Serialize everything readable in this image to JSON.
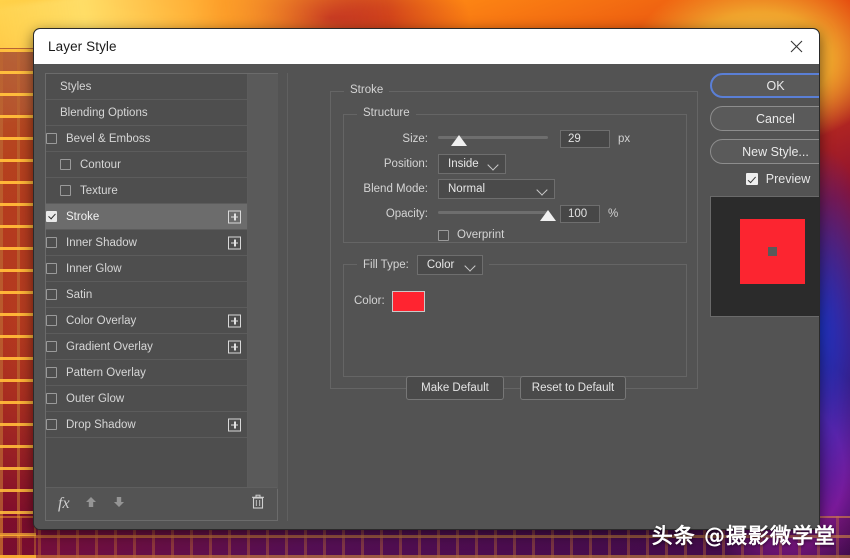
{
  "window": {
    "title": "Layer Style",
    "close_icon": "close-icon"
  },
  "styles_panel": {
    "items": [
      {
        "label": "Styles",
        "type": "plain",
        "checkbox": false,
        "checked": false,
        "indent": 0,
        "selected": false,
        "plus": false
      },
      {
        "label": "Blending Options",
        "type": "plain",
        "checkbox": false,
        "checked": false,
        "indent": 0,
        "selected": false,
        "plus": false
      },
      {
        "label": "Bevel & Emboss",
        "type": "check",
        "checkbox": true,
        "checked": false,
        "indent": 0,
        "selected": false,
        "plus": false
      },
      {
        "label": "Contour",
        "type": "check",
        "checkbox": true,
        "checked": false,
        "indent": 1,
        "selected": false,
        "plus": false
      },
      {
        "label": "Texture",
        "type": "check",
        "checkbox": true,
        "checked": false,
        "indent": 1,
        "selected": false,
        "plus": false
      },
      {
        "label": "Stroke",
        "type": "check",
        "checkbox": true,
        "checked": true,
        "indent": 0,
        "selected": true,
        "plus": true
      },
      {
        "label": "Inner Shadow",
        "type": "check",
        "checkbox": true,
        "checked": false,
        "indent": 0,
        "selected": false,
        "plus": true
      },
      {
        "label": "Inner Glow",
        "type": "check",
        "checkbox": true,
        "checked": false,
        "indent": 0,
        "selected": false,
        "plus": false
      },
      {
        "label": "Satin",
        "type": "check",
        "checkbox": true,
        "checked": false,
        "indent": 0,
        "selected": false,
        "plus": false
      },
      {
        "label": "Color Overlay",
        "type": "check",
        "checkbox": true,
        "checked": false,
        "indent": 0,
        "selected": false,
        "plus": true
      },
      {
        "label": "Gradient Overlay",
        "type": "check",
        "checkbox": true,
        "checked": false,
        "indent": 0,
        "selected": false,
        "plus": true
      },
      {
        "label": "Pattern Overlay",
        "type": "check",
        "checkbox": true,
        "checked": false,
        "indent": 0,
        "selected": false,
        "plus": false
      },
      {
        "label": "Outer Glow",
        "type": "check",
        "checkbox": true,
        "checked": false,
        "indent": 0,
        "selected": false,
        "plus": false
      },
      {
        "label": "Drop Shadow",
        "type": "check",
        "checkbox": true,
        "checked": false,
        "indent": 0,
        "selected": false,
        "plus": true
      }
    ],
    "footer": {
      "fx_icon": "fx-icon",
      "move_up_icon": "arrow-up-icon",
      "move_down_icon": "arrow-down-icon",
      "delete_icon": "trash-icon"
    }
  },
  "options": {
    "group_title": "Stroke",
    "structure": {
      "title": "Structure",
      "size": {
        "label": "Size:",
        "value": "29",
        "unit": "px",
        "slider_percent": 19
      },
      "position": {
        "label": "Position:",
        "value": "Inside"
      },
      "blend_mode": {
        "label": "Blend Mode:",
        "value": "Normal"
      },
      "opacity": {
        "label": "Opacity:",
        "value": "100",
        "unit": "%",
        "slider_percent": 100
      },
      "overprint": {
        "label": "Overprint",
        "checked": false
      }
    },
    "fill": {
      "fill_type_label": "Fill Type:",
      "fill_type_value": "Color",
      "color_label": "Color:",
      "color_value": "#FF2430"
    },
    "make_default_label": "Make Default",
    "reset_default_label": "Reset to Default"
  },
  "right": {
    "ok_label": "OK",
    "cancel_label": "Cancel",
    "new_style_label": "New Style...",
    "preview_label": "Preview",
    "preview_checked": true,
    "preview_swatch_color": "#FC2530"
  },
  "watermark": {
    "text": "头条 @摄影微学堂"
  }
}
